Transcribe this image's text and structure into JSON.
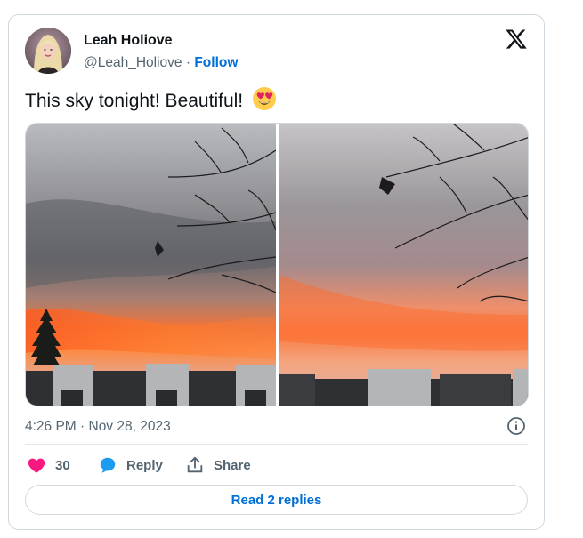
{
  "author": {
    "name": "Leah Holiove",
    "handle": "@Leah_Holiove",
    "separator": "·",
    "follow_label": "Follow"
  },
  "tweet": {
    "text": "This sky tonight! Beautiful!",
    "emoji": "heart-eyes-emoji"
  },
  "meta": {
    "timestamp": "4:26 PM · Nov 28, 2023"
  },
  "actions": {
    "like_count": "30",
    "reply_label": "Reply",
    "share_label": "Share"
  },
  "footer": {
    "read_replies_label": "Read 2 replies"
  },
  "colors": {
    "link": "#006fd6",
    "like": "#f91880",
    "reply": "#1d9bf0",
    "muted": "#536471"
  }
}
